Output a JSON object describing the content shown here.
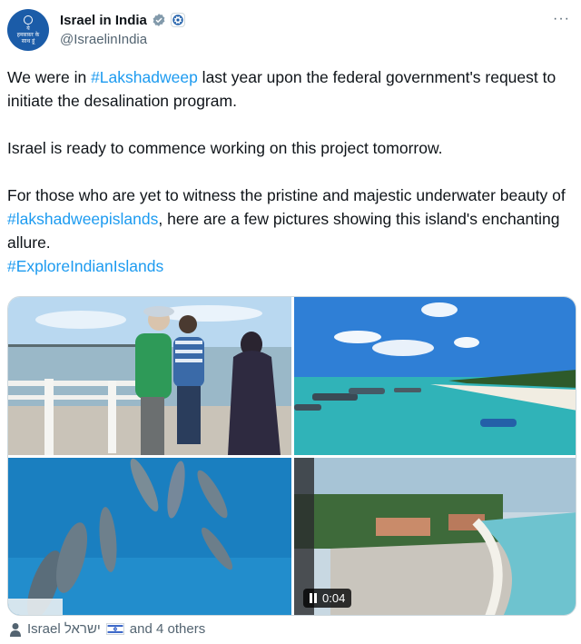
{
  "author": {
    "display_name": "Israel in India",
    "handle": "@IsraelinIndia",
    "avatar_text": [
      "ये",
      "हमसफ़र के",
      "साथ हूं"
    ]
  },
  "tweet": {
    "line1_pre": "We were in ",
    "line1_tag": "#Lakshadweep",
    "line1_post": " last year upon the federal government's request to initiate the desalination program.",
    "para2": "Israel is ready to commence working on this project tomorrow.",
    "para3_pre": "For those who are yet to witness the pristine and majestic underwater beauty of ",
    "para3_tag": "#lakshadweepislands",
    "para3_post": ", here are a few pictures showing this island's enchanting allure.",
    "closing_tag": "#ExploreIndianIslands"
  },
  "media": {
    "video_duration": "0:04"
  },
  "tagged": {
    "name": "Israel ישראל",
    "others": "and 4 others"
  },
  "colors": {
    "accent": "#1d9bf0",
    "text": "#0f1419",
    "muted": "#536471",
    "avatar_bg": "#1b5ca8"
  },
  "icons": [
    "verified-badge-icon",
    "affiliation-badge-icon",
    "more-options-icon",
    "pause-icon",
    "person-icon",
    "israel-flag-icon"
  ]
}
